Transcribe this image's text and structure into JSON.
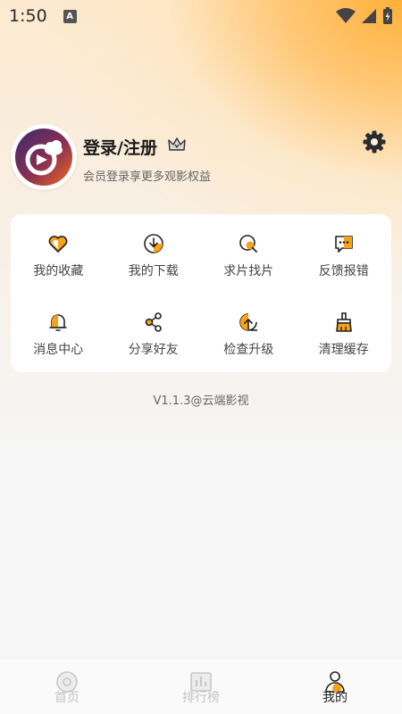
{
  "status_bar": {
    "time": "1:50",
    "notification_letter": "A"
  },
  "profile": {
    "login_label": "登录/注册",
    "subtitle": "会员登录享更多观影权益"
  },
  "menu": [
    {
      "label": "我的收藏",
      "icon": "favorite-heart-icon"
    },
    {
      "label": "我的下载",
      "icon": "download-icon"
    },
    {
      "label": "求片找片",
      "icon": "search-film-icon"
    },
    {
      "label": "反馈报错",
      "icon": "feedback-icon"
    },
    {
      "label": "消息中心",
      "icon": "bell-icon"
    },
    {
      "label": "分享好友",
      "icon": "share-icon"
    },
    {
      "label": "检查升级",
      "icon": "upgrade-icon"
    },
    {
      "label": "清理缓存",
      "icon": "clear-cache-icon"
    }
  ],
  "version": "V1.1.3@云端影视",
  "tabs": [
    {
      "label": "首页",
      "icon": "home-icon",
      "active": false
    },
    {
      "label": "排行榜",
      "icon": "ranking-icon",
      "active": false
    },
    {
      "label": "我的",
      "icon": "profile-icon",
      "active": true
    }
  ],
  "colors": {
    "accent": "#f7a21b",
    "brand_orange": "#f26b1d",
    "brand_purple": "#3b2b6e"
  }
}
